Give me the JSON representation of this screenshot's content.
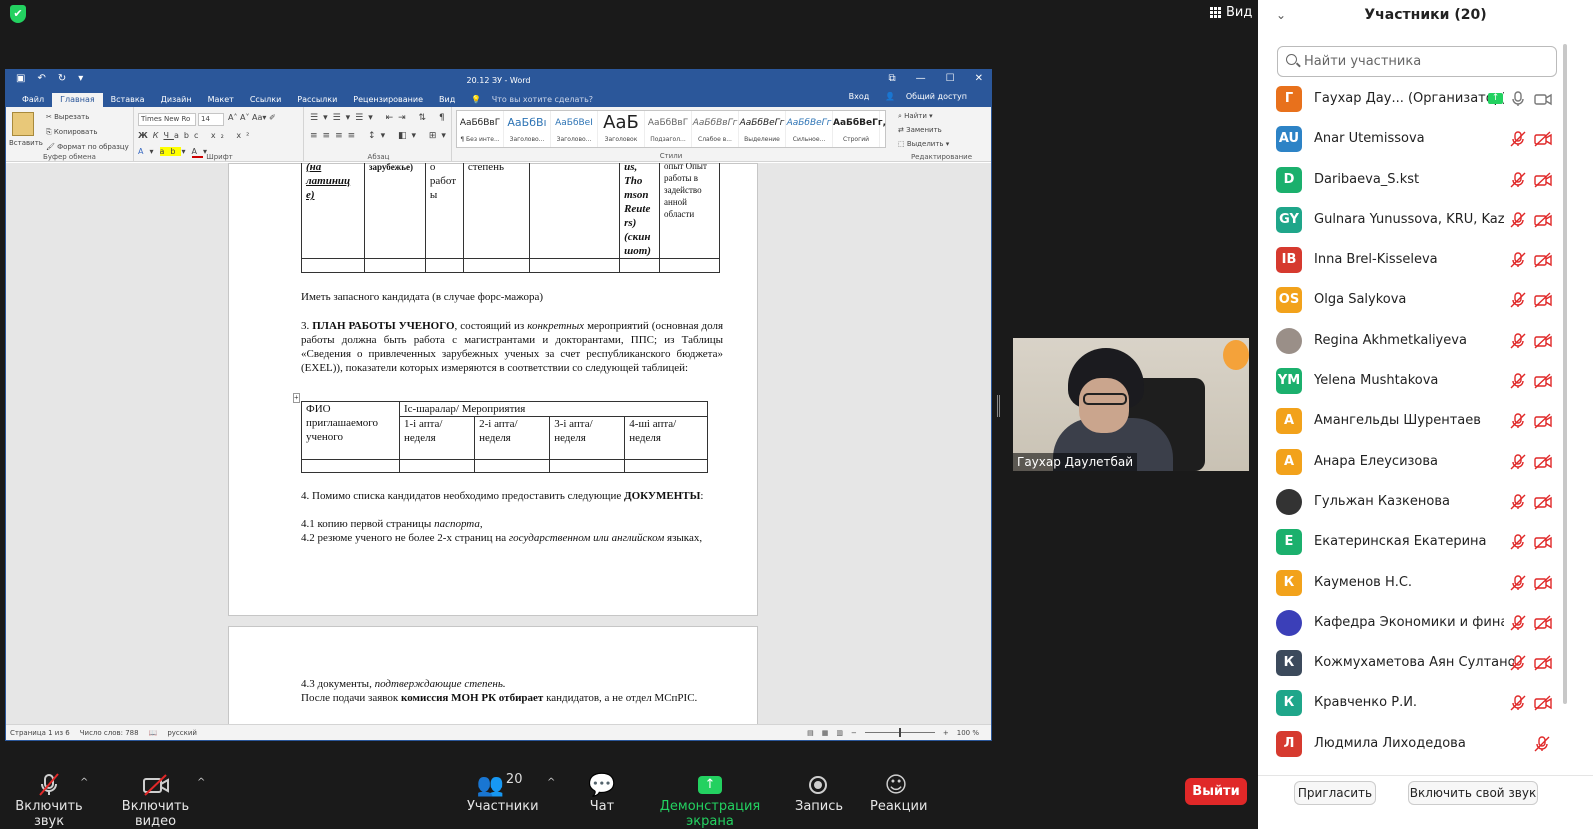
{
  "top": {
    "view_label": "Вид"
  },
  "word": {
    "title": "20.12 ЗУ - Word",
    "menu": [
      "Файл",
      "Главная",
      "Вставка",
      "Дизайн",
      "Макет",
      "Ссылки",
      "Рассылки",
      "Рецензирование",
      "Вид"
    ],
    "tell_me": "Что вы хотите сделать?",
    "signin": "Вход",
    "share": "Общий доступ",
    "clipboard": {
      "paste": "Вставить",
      "cut": "Вырезать",
      "copy": "Копировать",
      "format_painter": "Формат по образцу",
      "group": "Буфер обмена"
    },
    "font": {
      "name": "Times New Ro",
      "size": "14",
      "group": "Шрифт"
    },
    "paragraph_group": "Абзац",
    "styles": [
      {
        "sample": "АаБбВвГ",
        "name": "¶ Без инте..."
      },
      {
        "sample": "АаБбВı",
        "name": "Заголово..."
      },
      {
        "sample": "АаБбВеІ",
        "name": "Заголово..."
      },
      {
        "sample": "АаБ",
        "name": "Заголовок"
      },
      {
        "sample": "АаБбВвГ",
        "name": "Подзагол..."
      },
      {
        "sample": "АаБбВвГг",
        "name": "Слабое в..."
      },
      {
        "sample": "АаБбВеГг",
        "name": "Выделение"
      },
      {
        "sample": "АаБбВеГг",
        "name": "Сильное..."
      },
      {
        "sample": "АаБбВеГг,",
        "name": "Строгий"
      }
    ],
    "styles_group": "Стили",
    "editing": {
      "find": "Найти",
      "replace": "Заменить",
      "select": "Выделить",
      "group": "Редактирование"
    },
    "doc": {
      "t_c1": "(на латиниц е)",
      "t_c2": "зарубежье)",
      "t_c3": "о работ ы",
      "t_c4": "степень",
      "t_c6": "us, Tho mson Reute rs) (скин шот)",
      "t_c7": "опыт Опыт работы в задейство анной области",
      "p1": "Иметь запасного кандидата (в случае форс-мажора)",
      "p2_num": "3.",
      "p2_bold": "ПЛАН РАБОТЫ УЧЕНОГО",
      "p2_a": ", состоящий из",
      "p2_italic": "конкретных",
      "p2_b": "мероприятий (основная доля работы должна быть работа с магистрантами и докторантами, ППС; из Таблицы «Сведения о привлеченных зарубежных ученых за счет республиканского бюджета» (EXEL)), показатели которых измеряются в соответствии со следующей таблицей:",
      "t2": {
        "h1": "ФИО приглашаемого ученого",
        "h2": "Іс-шаралар/ Мероприятия",
        "weeks": [
          "1-і апта/неделя",
          "2-і апта/неделя",
          "3-і апта/неделя",
          "4-ші апта/неделя"
        ]
      },
      "p3_a": "4. Помимо списка кандидатов необходимо предоставить следующие",
      "p3_bold": "ДОКУМЕНТЫ",
      "p3_b": ":",
      "p4_a": "4.1 копию первой страницы",
      "p4_i": "паспорта",
      "p4_b": ",",
      "p5_a": "4.2 резюме ученого не более 2-х страниц на",
      "p5_i": "государственном или английском",
      "p5_b": "языках,",
      "p6_a": "4.3 документы,",
      "p6_i": "подтверждающие степень.",
      "p7_a": "После подачи заявок",
      "p7_bold": "комиссия МОН РК отбирает",
      "p7_b": "кандидатов, а не отдел МСпРІС."
    },
    "status": {
      "page": "Страница 1 из 6",
      "words": "Число слов: 788",
      "lang": "русский",
      "zoom": "100 %"
    }
  },
  "video": {
    "name": "Гаухар Даулетбай"
  },
  "toolbar": {
    "audio": "Включить звук",
    "video": "Включить видео",
    "participants": "Участники",
    "participants_count": "20",
    "chat": "Чат",
    "share": "Демонстрация экрана",
    "record": "Запись",
    "reactions": "Реакции",
    "leave": "Выйти"
  },
  "panel": {
    "title": "Участники (20)",
    "search_placeholder": "Найти участника",
    "participants": [
      {
        "initials": "Г",
        "name": "Гаухар Дау...  (Организатор)",
        "color": "#e8711c",
        "host": true
      },
      {
        "initials": "AU",
        "name": "Anar Utemissova",
        "color": "#2d83c6"
      },
      {
        "initials": "D",
        "name": "Daribaeva_S.kst",
        "color": "#1bb06d"
      },
      {
        "initials": "GY",
        "name": "Gulnara Yunussova, KRU, Kazak...",
        "color": "#1fa68a"
      },
      {
        "initials": "IB",
        "name": "Inna Brel-Kisseleva",
        "color": "#d63a2f"
      },
      {
        "initials": "OS",
        "name": "Olga Salykova",
        "color": "#f2a21b"
      },
      {
        "initials": "",
        "name": "Regina Akhmetkaliyeva",
        "color": "#9a8f88",
        "photo": true
      },
      {
        "initials": "YM",
        "name": "Yelena Mushtakova",
        "color": "#1bb06d"
      },
      {
        "initials": "А",
        "name": "Амангельды Шурентаев",
        "color": "#f2a21b"
      },
      {
        "initials": "А",
        "name": "Анара Елеусизова",
        "color": "#f2a21b"
      },
      {
        "initials": "",
        "name": "Гульжан Казкенова",
        "color": "#333",
        "photo": true
      },
      {
        "initials": "Е",
        "name": "Екатеринская Екатерина",
        "color": "#1bb06d"
      },
      {
        "initials": "К",
        "name": "Кауменов Н.С.",
        "color": "#f2a21b"
      },
      {
        "initials": "",
        "name": "Кафедра Экономики и финанс...",
        "color": "#3b3fb8",
        "photo": true
      },
      {
        "initials": "К",
        "name": "Кожмухаметова Аян Султановна",
        "color": "#3c4a5c"
      },
      {
        "initials": "К",
        "name": "Кравченко Р.И.",
        "color": "#1fa68a"
      },
      {
        "initials": "Л",
        "name": "Людмила  Лиходедова",
        "color": "#d63a2f"
      }
    ],
    "invite": "Пригласить",
    "unmute_me": "Включить свой звук"
  }
}
